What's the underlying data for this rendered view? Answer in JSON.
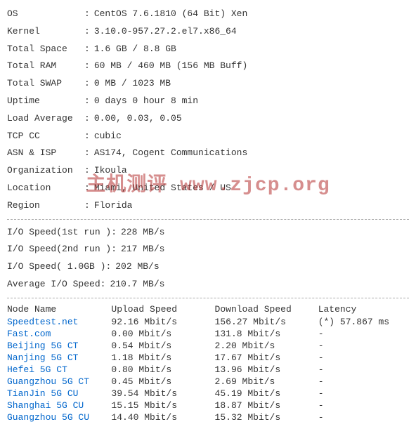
{
  "sysinfo": {
    "os_label": "OS",
    "os_value": "CentOS 7.6.1810 (64 Bit) Xen",
    "kernel_label": "Kernel",
    "kernel_value": "3.10.0-957.27.2.el7.x86_64",
    "totalspace_label": "Total Space",
    "totalspace_value": "1.6 GB / 8.8 GB",
    "totalram_label": "Total RAM",
    "totalram_value": "60 MB / 460 MB (156 MB Buff)",
    "totalswap_label": "Total SWAP",
    "totalswap_value": "0 MB / 1023 MB",
    "uptime_label": "Uptime",
    "uptime_value": "0 days 0 hour 8 min",
    "loadavg_label": "Load Average",
    "loadavg_value": "0.00, 0.03, 0.05",
    "tcpcc_label": "TCP CC",
    "tcpcc_value": "cubic",
    "asnisp_label": "ASN & ISP",
    "asnisp_value": "AS174, Cogent Communications",
    "org_label": "Organization",
    "org_value": "Ikoula",
    "location_label": "Location",
    "location_value": "Miami, United States / US",
    "region_label": "Region",
    "region_value": "Florida"
  },
  "io": {
    "io1_label": "I/O Speed(",
    "io1_unit": "1st run )",
    "io1_value": "228 MB/s",
    "io2_label": "I/O Speed(",
    "io2_unit": "2nd run )",
    "io2_value": "217 MB/s",
    "io3_label": "I/O Speed( 1.0GB )",
    "io3_value": "202 MB/s",
    "avg_label": "Average I/O Speed",
    "avg_value": "210.7 MB/s"
  },
  "speedtest": {
    "col_node": "Node Name",
    "col_upload": "Upload Speed",
    "col_download": "Download Speed",
    "col_latency": "Latency",
    "rows": [
      {
        "node": "Speedtest.net",
        "upload": "92.16 Mbit/s",
        "download": "156.27 Mbit/s",
        "latency": "(*) 57.867 ms"
      },
      {
        "node": "Fast.com",
        "upload": "0.00 Mbit/s",
        "download": "131.8 Mbit/s",
        "latency": "-"
      },
      {
        "node": "Beijing 5G   CT",
        "upload": "0.54 Mbit/s",
        "download": "2.20 Mbit/s",
        "latency": "-"
      },
      {
        "node": "Nanjing 5G   CT",
        "upload": "1.18 Mbit/s",
        "download": "17.67 Mbit/s",
        "latency": "-"
      },
      {
        "node": "Hefei 5G    CT",
        "upload": "0.80 Mbit/s",
        "download": "13.96 Mbit/s",
        "latency": "-"
      },
      {
        "node": "Guangzhou 5G CT",
        "upload": "0.45 Mbit/s",
        "download": "2.69 Mbit/s",
        "latency": "-"
      },
      {
        "node": "TianJin 5G  CU",
        "upload": "39.54 Mbit/s",
        "download": "45.19 Mbit/s",
        "latency": "-"
      },
      {
        "node": "Shanghai 5G  CU",
        "upload": "15.15 Mbit/s",
        "download": "18.87 Mbit/s",
        "latency": "-"
      },
      {
        "node": "Guangzhou 5G CU",
        "upload": "14.40 Mbit/s",
        "download": "15.32 Mbit/s",
        "latency": "-"
      }
    ]
  },
  "watermark": "主机测评 www.zjcp.org"
}
